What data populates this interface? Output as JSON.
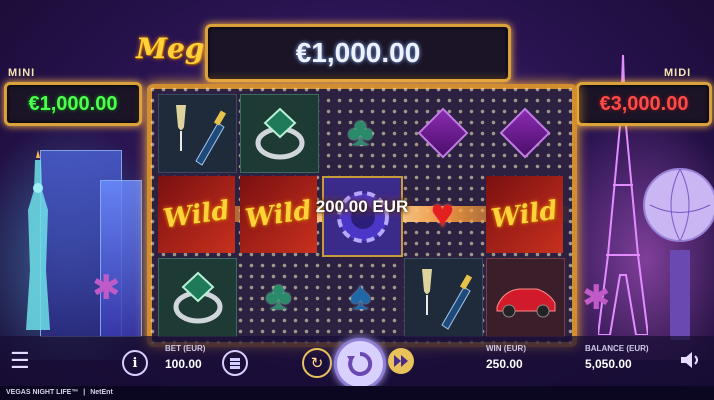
{
  "game": {
    "title": "VEGAS NIGHT LIFE™",
    "provider": "NetEnt",
    "separator": "|"
  },
  "jackpots": {
    "mega": {
      "label": "Mega",
      "value": "€1,000.00"
    },
    "mini": {
      "label": "MINI",
      "value": "€1,000.00"
    },
    "midi": {
      "label": "MIDI",
      "value": "€3,000.00"
    }
  },
  "reels": {
    "win_amount": "200.00 EUR",
    "wild_label": "Wild",
    "grid": [
      [
        "champagne",
        "ring",
        "club",
        "diamond",
        "diamond"
      ],
      [
        "wild",
        "wild",
        "chip",
        "heart",
        "wild"
      ],
      [
        "ring",
        "club",
        "spade",
        "champagne",
        "car"
      ]
    ]
  },
  "controls": {
    "bet_label": "BET (EUR)",
    "bet_value": "100.00",
    "win_label": "WIN (EUR)",
    "win_value": "250.00",
    "balance_label": "BALANCE (EUR)",
    "balance_value": "5,050.00"
  },
  "symbols": {
    "club": "♣",
    "spade": "♠",
    "heart": "♥",
    "menu": "☰",
    "info": "i",
    "autoplay": "↻",
    "fast_forward": "⏩",
    "sound": "🔊"
  },
  "colors": {
    "gold": "#d18d2e",
    "accent_green": "#4cff4c",
    "accent_red": "#ff4a4a"
  }
}
